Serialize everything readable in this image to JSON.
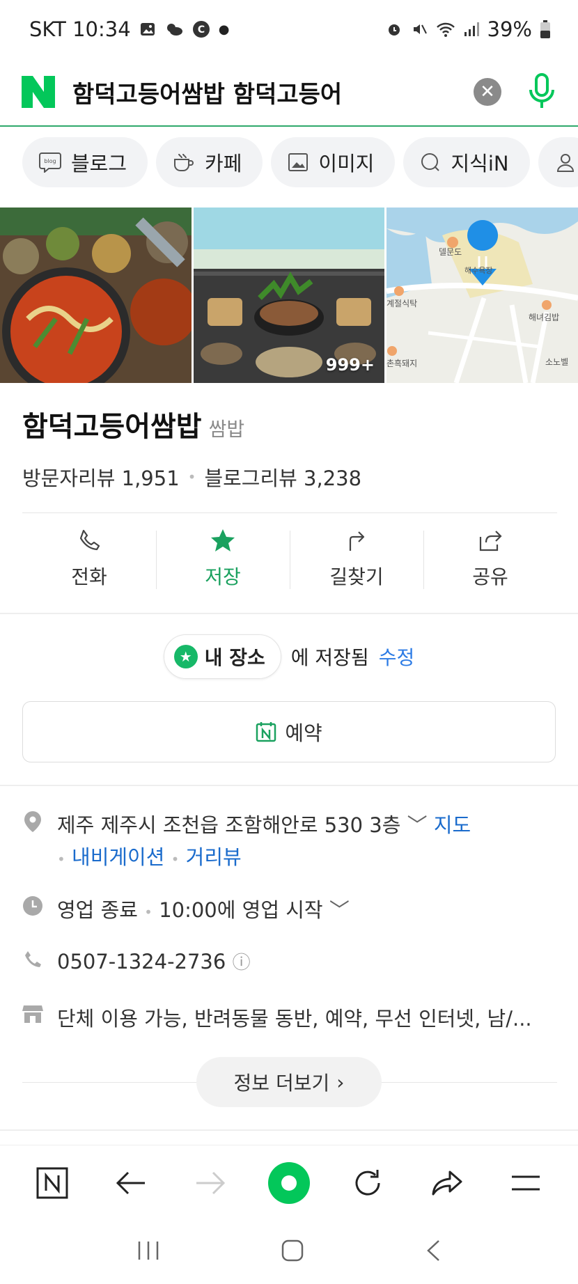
{
  "status_bar": {
    "carrier_time": "SKT 10:34",
    "battery": "39%"
  },
  "search": {
    "query": "함덕고등어쌈밥 함덕고등어"
  },
  "tabs": [
    {
      "label": "블로그",
      "icon": "blog-icon"
    },
    {
      "label": "카페",
      "icon": "cafe-cup-icon"
    },
    {
      "label": "이미지",
      "icon": "image-icon"
    },
    {
      "label": "지식iN",
      "icon": "knowledge-icon"
    },
    {
      "label": "",
      "icon": "person-icon"
    }
  ],
  "gallery": {
    "photo_count": "999+"
  },
  "map_labels": [
    "델문도",
    "해수욕장",
    "해녀김밥",
    "계절식탁",
    "촌흑돼지",
    "소노벨"
  ],
  "place": {
    "name": "함덕고등어쌈밥",
    "category": "쌈밥",
    "visitor_reviews": "방문자리뷰 1,951",
    "blog_reviews": "블로그리뷰 3,238"
  },
  "actions": [
    {
      "label": "전화",
      "icon": "phone-icon"
    },
    {
      "label": "저장",
      "icon": "star-icon"
    },
    {
      "label": "길찾기",
      "icon": "directions-icon"
    },
    {
      "label": "공유",
      "icon": "share-icon"
    }
  ],
  "saved": {
    "chip": "내 장소",
    "text": "에 저장됨",
    "edit": "수정"
  },
  "reserve": {
    "label": "예약"
  },
  "info": {
    "address": "제주 제주시 조천읍 조함해안로 530 3층",
    "map_link": "지도",
    "navi_link": "내비게이션",
    "street_link": "거리뷰",
    "hours_status": "영업 종료",
    "hours_next": "10:00에 영업 시작",
    "phone": "0507-1324-2736",
    "amenities": "단체 이용 가능, 반려동물 동반, 예약, 무선 인터넷, 남/..."
  },
  "more": {
    "label": "정보 더보기"
  },
  "colors": {
    "naver_green": "#03c75a",
    "link_blue": "#1a6bcc",
    "active_green": "#1aa15f"
  }
}
